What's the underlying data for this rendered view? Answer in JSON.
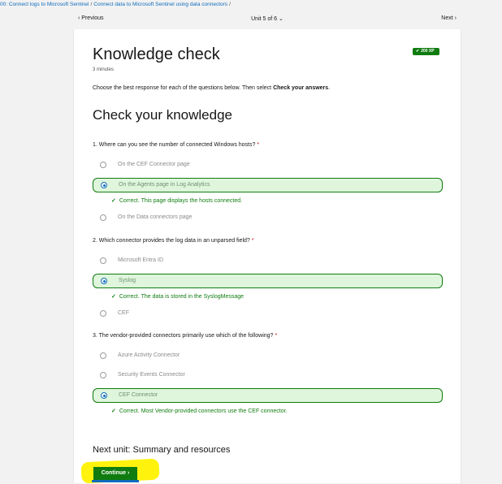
{
  "breadcrumb": {
    "items": [
      "00: Connect logs to Microsoft Sentinel",
      "Connect data to Microsoft Sentinel using data connectors"
    ],
    "separator": "/"
  },
  "unit_nav": {
    "previous": "Previous",
    "unit": "Unit 5 of 6",
    "next": "Next"
  },
  "page": {
    "title": "Knowledge check",
    "duration": "3 minutes",
    "xp": "200 XP",
    "instructions_prefix": "Choose the best response for each of the questions below. Then select ",
    "instructions_bold": "Check your answers",
    "instructions_suffix": ".",
    "section_title": "Check your knowledge"
  },
  "questions": [
    {
      "text": "1. Where can you see the number of connected Windows hosts?",
      "required_mark": "*",
      "options": [
        "On the CEF Connector page",
        "On the Agents page in Log Analytics",
        "On the Data connectors page"
      ],
      "selected": 1,
      "feedback": "Correct. This page displays the hosts connected."
    },
    {
      "text": "2. Which connector provides the log data in an unparsed field?",
      "required_mark": "*",
      "options": [
        "Microsoft Entra ID",
        "Syslog",
        "CEF"
      ],
      "selected": 1,
      "feedback": "Correct. The data is stored in the SyslogMessage"
    },
    {
      "text": "3. The vendor-provided connectors primarily use which of the following?",
      "required_mark": "*",
      "options": [
        "Azure Activity Connector",
        "Security Events Connector",
        "CEF Connector"
      ],
      "selected": 2,
      "feedback": "Correct. Most Vendor-provided connectors use the CEF connector."
    }
  ],
  "next_unit": {
    "title": "Next unit: Summary and resources",
    "button": "Continue"
  },
  "colors": {
    "accent": "#0f6cbd",
    "success": "#107c10",
    "success_bg": "#dff6dd",
    "highlight": "#fff200"
  },
  "icons": [
    "chevron-left-icon",
    "chevron-down-icon",
    "chevron-right-icon",
    "checkmark-icon"
  ]
}
